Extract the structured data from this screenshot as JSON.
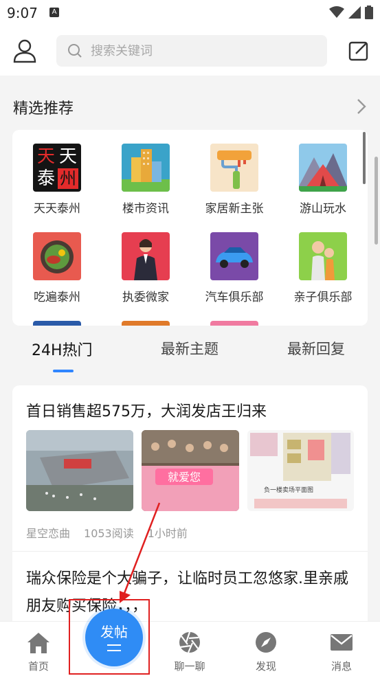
{
  "status": {
    "time": "9:07",
    "notif_letter": "A"
  },
  "header": {
    "search_placeholder": "搜索关键词"
  },
  "section": {
    "title": "精选推荐"
  },
  "grid": [
    {
      "label": "天天泰州",
      "icon": "tiantian-taizhou-logo",
      "logo_text_1": "天",
      "logo_text_2": "天",
      "logo_text_3": "泰",
      "logo_text_4": "州"
    },
    {
      "label": "楼市资讯",
      "icon": "buildings-icon"
    },
    {
      "label": "家居新主张",
      "icon": "paint-roller-icon"
    },
    {
      "label": "游山玩水",
      "icon": "tent-mountain-icon"
    },
    {
      "label": "吃遍泰州",
      "icon": "food-plate-icon"
    },
    {
      "label": "执委微家",
      "icon": "businesswoman-icon"
    },
    {
      "label": "汽车俱乐部",
      "icon": "car-icon"
    },
    {
      "label": "亲子俱乐部",
      "icon": "parent-child-icon"
    }
  ],
  "tabs": [
    {
      "label": "24H热门",
      "active": true
    },
    {
      "label": "最新主题",
      "active": false
    },
    {
      "label": "最新回复",
      "active": false
    }
  ],
  "posts": [
    {
      "title": "首日销售超575万，大润发店王归来",
      "author": "星空恋曲",
      "reads": "1053阅读",
      "time": "1小时前",
      "image2_caption": "就爱您",
      "image3_caption": "负一楼卖场平面图"
    },
    {
      "title": "瑞众保险是个大骗子，让临时员工忽悠家.里亲戚朋友购买保险，，，"
    }
  ],
  "bottom_nav": [
    {
      "label": "首页",
      "icon": "home-icon"
    },
    {
      "label": "发帖",
      "icon": "post-icon"
    },
    {
      "label": "聊一聊",
      "icon": "chat-aperture-icon"
    },
    {
      "label": "发现",
      "icon": "compass-icon"
    },
    {
      "label": "消息",
      "icon": "mail-icon"
    }
  ],
  "colors": {
    "accent": "#2f8cf5",
    "highlight": "#e02020"
  }
}
